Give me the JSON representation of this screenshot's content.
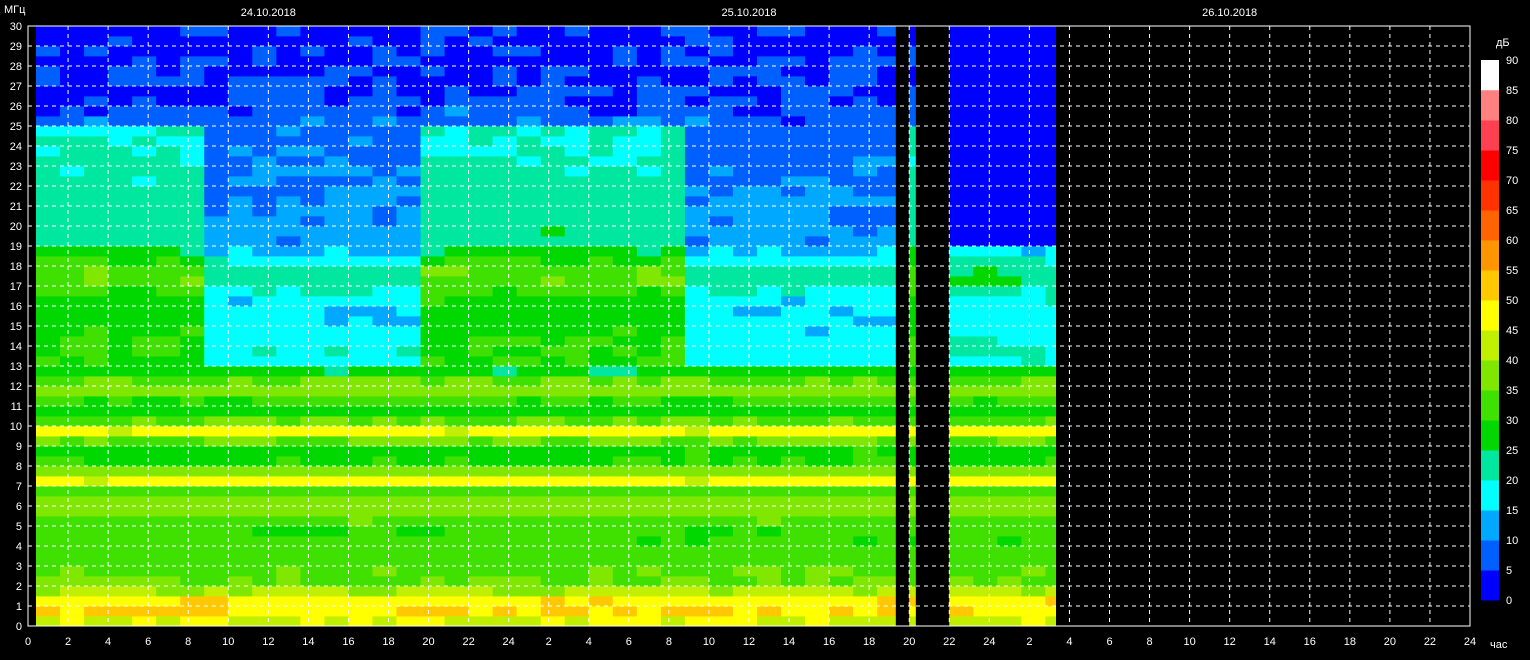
{
  "chart_data": {
    "type": "heatmap",
    "ylabel": "МГц",
    "xlabel": "час",
    "colorbar_label": "дБ",
    "dates": [
      "24.10.2018",
      "25.10.2018",
      "26.10.2018"
    ],
    "ylim": [
      0,
      30
    ],
    "yticks": [
      "0",
      "1",
      "2",
      "3",
      "4",
      "5",
      "6",
      "7",
      "8",
      "9",
      "10",
      "11",
      "12",
      "13",
      "14",
      "15",
      "16",
      "17",
      "18",
      "19",
      "20",
      "21",
      "22",
      "23",
      "24",
      "25",
      "26",
      "27",
      "28",
      "29",
      "30"
    ],
    "xticks": [
      "0",
      "2",
      "4",
      "6",
      "8",
      "10",
      "12",
      "14",
      "16",
      "18",
      "20",
      "22",
      "24",
      "2",
      "4",
      "6",
      "8",
      "10",
      "12",
      "14",
      "16",
      "18",
      "20",
      "22",
      "24",
      "2",
      "4",
      "6",
      "8",
      "10",
      "12",
      "14",
      "16",
      "18",
      "20",
      "22",
      "24"
    ],
    "colorbar_ticks": [
      "0",
      "5",
      "10",
      "15",
      "20",
      "25",
      "30",
      "35",
      "40",
      "45",
      "50",
      "55",
      "60",
      "65",
      "70",
      "75",
      "80",
      "85",
      "90"
    ],
    "colorbar_colors": [
      "#0000ff",
      "#0060ff",
      "#00a8ff",
      "#00ffff",
      "#00e8a0",
      "#00d800",
      "#40e000",
      "#80e800",
      "#c0f000",
      "#ffff00",
      "#ffc800",
      "#ff9600",
      "#ff6400",
      "#ff3200",
      "#ff0000",
      "#ff4050",
      "#ff8080",
      "#ffb8b8",
      "#ffffff"
    ],
    "grid": true,
    "data_segments": [
      {
        "start_hour": 0.4,
        "end_hour": 43.3
      },
      {
        "start_hour": 44.0,
        "end_hour": 44.3
      },
      {
        "start_hour": 46.0,
        "end_hour": 51.3
      }
    ],
    "profile": [
      {
        "mhz": 0,
        "db": 42
      },
      {
        "mhz": 0.5,
        "db": 48
      },
      {
        "mhz": 1,
        "db": 52
      },
      {
        "mhz": 1.5,
        "db": 46
      },
      {
        "mhz": 2,
        "db": 36
      },
      {
        "mhz": 3,
        "db": 33
      },
      {
        "mhz": 4,
        "db": 32
      },
      {
        "mhz": 5,
        "db": 31
      },
      {
        "mhz": 6,
        "db": 40
      },
      {
        "mhz": 7,
        "db": 30
      },
      {
        "mhz": 7.3,
        "db": 50
      },
      {
        "mhz": 8,
        "db": 30
      },
      {
        "mhz": 9,
        "db": 28
      },
      {
        "mhz": 9.7,
        "db": 48
      },
      {
        "mhz": 10.5,
        "db": 28
      },
      {
        "mhz": 11,
        "db": 27
      },
      {
        "mhz": 11.9,
        "db": 40
      },
      {
        "mhz": 13,
        "db": 23
      },
      {
        "mhz": 14,
        "db": 25
      },
      {
        "mhz": 15,
        "db": 22
      },
      {
        "mhz": 16,
        "db": 21
      },
      {
        "mhz": 17.6,
        "db": 30
      },
      {
        "mhz": 19,
        "db": 18
      },
      {
        "mhz": 22,
        "db": 16
      },
      {
        "mhz": 24.9,
        "db": 14
      },
      {
        "mhz": 25.1,
        "db": 7
      },
      {
        "mhz": 27,
        "db": 4
      },
      {
        "mhz": 30,
        "db": 3
      }
    ]
  }
}
